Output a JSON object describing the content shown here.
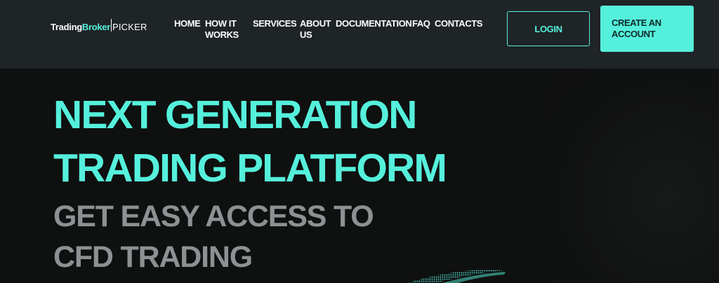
{
  "header": {
    "logo": {
      "part1": "Trading",
      "part2": "Broker",
      "part3": "PICKER"
    },
    "nav": [
      {
        "label": "HOME"
      },
      {
        "label": "HOW IT WORKS"
      },
      {
        "label": "SERVICES"
      },
      {
        "label": "ABOUT US"
      },
      {
        "label": "DOCUMENTATION"
      },
      {
        "label": "FAQ"
      },
      {
        "label": "CONTACTS"
      }
    ],
    "login_label": "LOGIN",
    "create_account_label": "CREATE AN ACCOUNT"
  },
  "hero": {
    "title_line1": "NEXT GENERATION",
    "title_line2": "TRADING PLATFORM",
    "subtitle_line1": "GET EASY ACCESS TO",
    "subtitle_line2": "CFD TRADING"
  },
  "colors": {
    "accent": "#55f0dc",
    "header_bg": "#1f2426",
    "page_bg": "#0f1010",
    "subtitle": "#8e9193"
  }
}
